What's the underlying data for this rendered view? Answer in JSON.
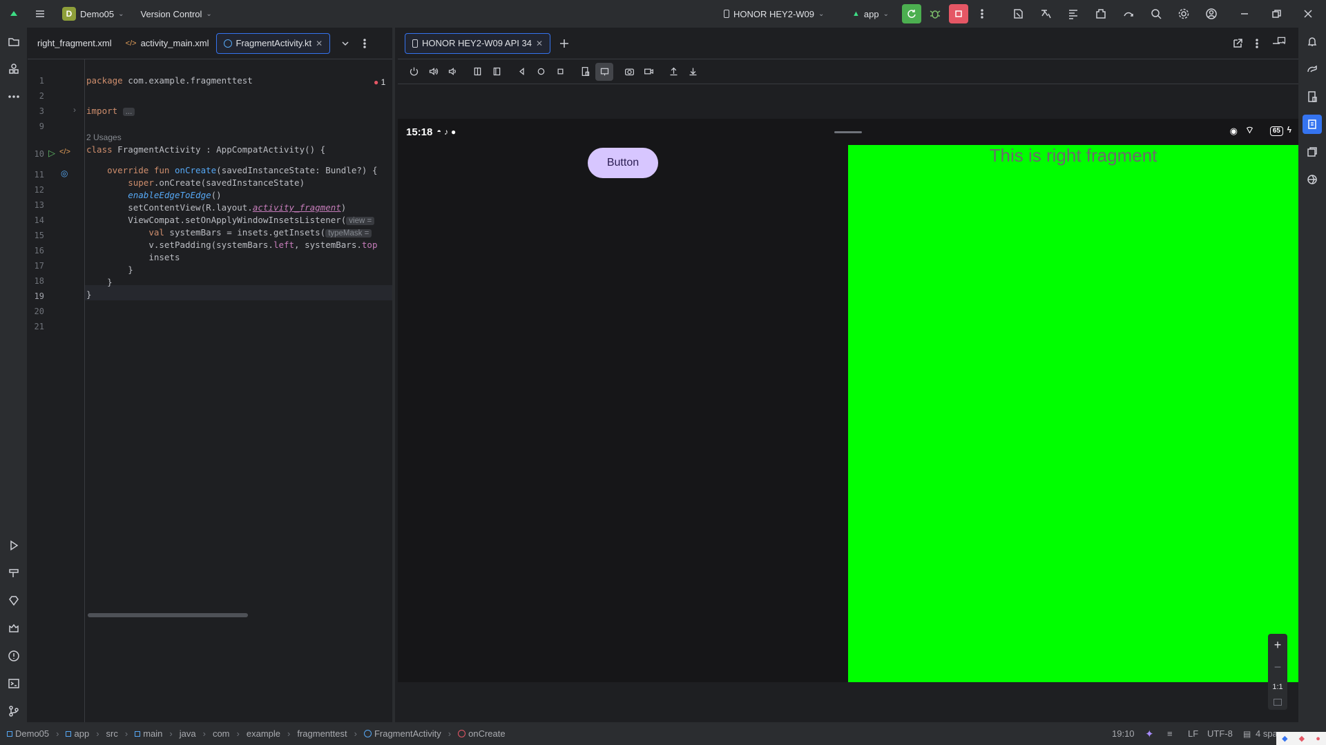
{
  "titlebar": {
    "project": "Demo05",
    "project_badge": "D",
    "version_control": "Version Control",
    "device": "HONOR HEY2-W09",
    "run_config": "app"
  },
  "editor": {
    "tabs": [
      {
        "label": "right_fragment.xml"
      },
      {
        "label": "activity_main.xml"
      },
      {
        "label": "FragmentActivity.kt"
      }
    ],
    "problem_count": "1",
    "usages": "2 Usages",
    "lines": [
      {
        "n": "1"
      },
      {
        "n": "2"
      },
      {
        "n": "3"
      },
      {
        "n": "9"
      },
      {
        "n": "10"
      },
      {
        "n": "11"
      },
      {
        "n": "12"
      },
      {
        "n": "13"
      },
      {
        "n": "14"
      },
      {
        "n": "15"
      },
      {
        "n": "16"
      },
      {
        "n": "17"
      },
      {
        "n": "18"
      },
      {
        "n": "19"
      },
      {
        "n": "20"
      },
      {
        "n": "21"
      }
    ],
    "code": {
      "l1_kw": "package",
      "l1_rest": " com.example.fragmenttest",
      "l3_kw": "import",
      "l3_fold": "...",
      "l10_kw": "class",
      "l10_rest": " FragmentActivity : AppCompatActivity() {",
      "l11_kw": "override fun",
      "l11_fn": "onCreate",
      "l11_rest": "(savedInstanceState: Bundle?) {",
      "l12_kw": "super",
      "l12_rest": ".onCreate(savedInstanceState)",
      "l13_it": "enableEdgeToEdge",
      "l13_rest": "()",
      "l14_a": "setContentView(R.layout.",
      "l14_b": "activity_fragment",
      "l14_c": ")",
      "l15_a": "ViewCompat.setOnApplyWindowInsetsListener(",
      "l15_hint": "view =",
      "l16_kw": "val",
      "l16_a": " systemBars = insets.getInsets(",
      "l16_hint": "typeMask =",
      "l17_a": "v.setPadding(systemBars.",
      "l17_b": "left",
      "l17_c": ", systemBars.",
      "l17_d": "top",
      "l18_a": "insets",
      "l19_a": "}",
      "l20_a": "}",
      "l21_a": "}"
    }
  },
  "device_panel": {
    "tab": "HONOR HEY2-W09 API 34",
    "phone": {
      "time": "15:18",
      "battery": "65",
      "button_label": "Button",
      "fragment_text": "This is right fragment"
    },
    "zoom": {
      "plus": "+",
      "minus": "−",
      "ratio": "1:1"
    }
  },
  "statusbar": {
    "breadcrumbs": [
      "Demo05",
      "app",
      "src",
      "main",
      "java",
      "com",
      "example",
      "fragmenttest",
      "FragmentActivity",
      "onCreate"
    ],
    "position": "19:10",
    "line_sep": "LF",
    "encoding": "UTF-8",
    "indent": "4 spa"
  },
  "colors": {
    "accent": "#3574f0",
    "fragment_green": "#00ff00",
    "button_purple": "#d7c6ff",
    "run_green": "#4caf50",
    "stop_red": "#e55765"
  }
}
